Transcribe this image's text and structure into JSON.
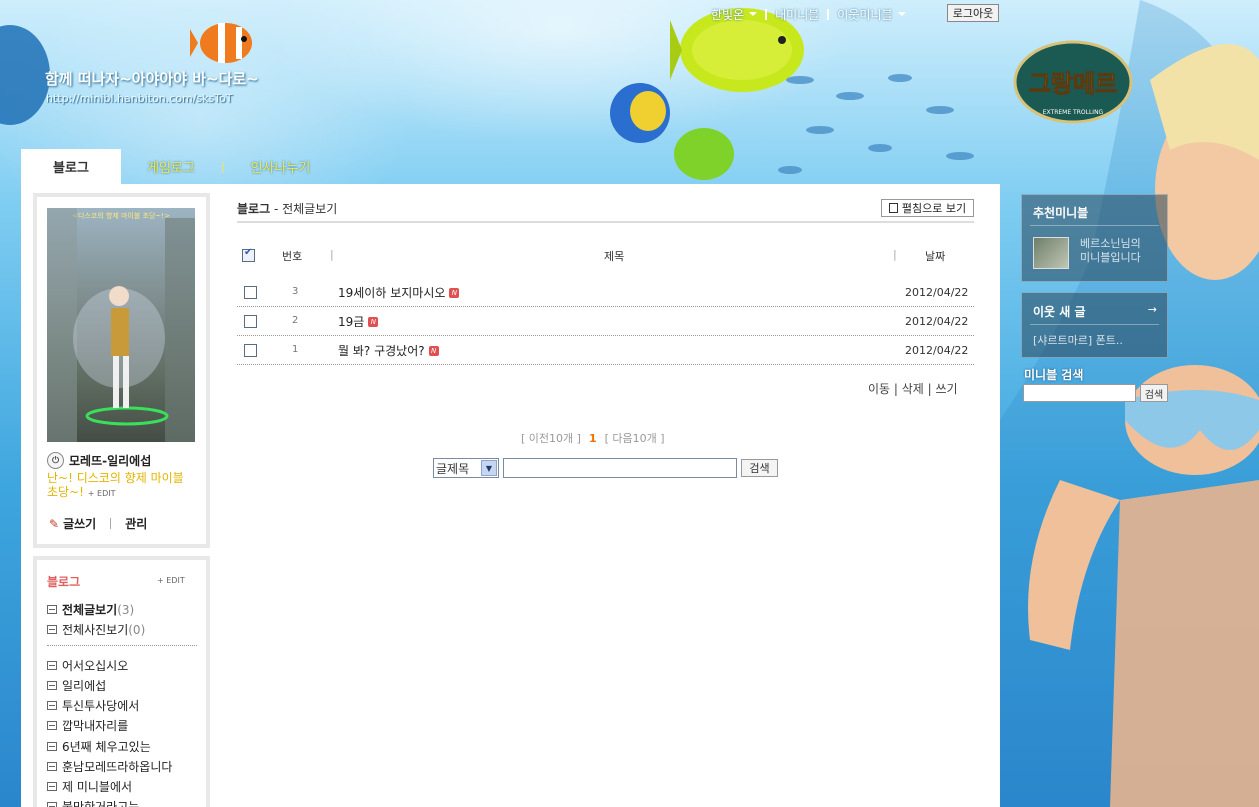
{
  "header": {
    "blog_title": "함께 떠나자~아야아야 바~다로~",
    "blog_url": "http://minibl.hanbiton.com/sksToT",
    "nav": [
      "한빛온",
      "내미니블",
      "이웃미니블"
    ],
    "logout_label": "로그아웃",
    "game_logo_text": "그랑메르",
    "game_logo_sub": "EXTREME TROLLING"
  },
  "tabs": {
    "active": "블로그",
    "items": [
      "게임로그",
      "인사나누기"
    ],
    "separator": "|"
  },
  "profile": {
    "avatar_caption": "<디스코의 향제 마이블 초당~!>",
    "name": "모레뜨-일리에섭",
    "message": "난~! 디스코의 향제 마이블 초당~!",
    "edit_label": "+ EDIT",
    "write_label": "글쓰기",
    "manage_label": "관리"
  },
  "categories": {
    "heading": "블로그",
    "edit_label": "+ EDIT",
    "all_posts": {
      "label": "전체글보기",
      "count": "(3)"
    },
    "all_photos": {
      "label": "전체사진보기",
      "count": "(0)"
    },
    "items": [
      "어서오십시오",
      "일리에섭",
      "투신투사당에서",
      "깝막내자리를",
      "6년째 체우고있는",
      "훈남모레뜨라하옵니다",
      "제 미니블에서",
      "불만한거라고는"
    ]
  },
  "content": {
    "breadcrumb_main": "블로그",
    "breadcrumb_sub": "- 전체글보기",
    "scrap_button": "펼침으로 보기",
    "columns": {
      "num": "번호",
      "title": "제목",
      "date": "날짜"
    },
    "rows": [
      {
        "num": "3",
        "title": "19세이하 보지마시오",
        "date": "2012/04/22",
        "badge": "N"
      },
      {
        "num": "2",
        "title": "19금",
        "date": "2012/04/22",
        "badge": "N"
      },
      {
        "num": "1",
        "title": "뭘 봐? 구경났어?",
        "date": "2012/04/22",
        "badge": "N"
      }
    ],
    "actions": "이동 | 삭제 | 쓰기",
    "pager_prev": "[ 이전10개 ]",
    "pager_current": "1",
    "pager_next": "[ 다음10개 ]",
    "search_select": "글제목",
    "search_button": "검색"
  },
  "sidebar": {
    "recommend_title": "추천미니블",
    "recommend_text_1": "베르소닌님의",
    "recommend_text_2": "미니블입니다",
    "neighbor_title": "이웃 새 글",
    "neighbor_arrow": "→",
    "neighbor_item": "[샤르트마르] 폰트..",
    "search_title": "미니블 검색",
    "search_button": "검색"
  },
  "colors": {
    "tab_text": "#f3e84b",
    "category_heading": "#e06060",
    "pager_current": "#f07000",
    "profile_message": "#e3b400"
  }
}
